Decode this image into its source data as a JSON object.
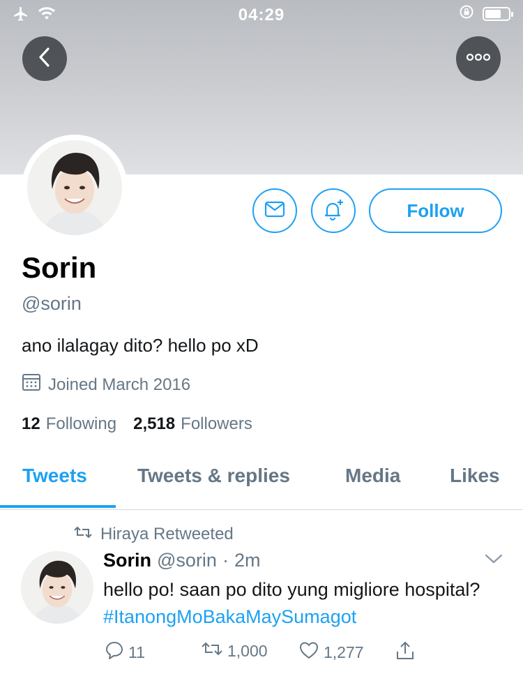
{
  "status_bar": {
    "time": "04:29",
    "icons": [
      "airplane-icon",
      "wifi-icon",
      "orientation-lock-icon",
      "battery-icon"
    ]
  },
  "header": {
    "back_icon": "chevron-left-icon",
    "more_icon": "more-horizontal-icon"
  },
  "profile": {
    "name": "Sorin",
    "handle": "@sorin",
    "bio": "ano ilalagay dito? hello po xD",
    "joined": "Joined March 2016",
    "following_count": "12",
    "following_label": "Following",
    "followers_count": "2,518",
    "followers_label": "Followers",
    "follow_label": "Follow"
  },
  "tabs": [
    {
      "label": "Tweets",
      "active": true
    },
    {
      "label": "Tweets & replies",
      "active": false
    },
    {
      "label": "Media",
      "active": false
    },
    {
      "label": "Likes",
      "active": false
    }
  ],
  "tweet": {
    "retweeted_by": "Hiraya Retweeted",
    "name": "Sorin",
    "handle": "@sorin",
    "separator": "·",
    "time": "2m",
    "text": "hello po! saan po dito yung migliore hospital?",
    "hashtag": "#ItanongMoBakaMaySumagot",
    "replies": "11",
    "retweets": "1,000",
    "likes": "1,277"
  },
  "colors": {
    "accent": "#1da1f2",
    "secondary_text": "#657786",
    "primary_text": "#14171a"
  }
}
